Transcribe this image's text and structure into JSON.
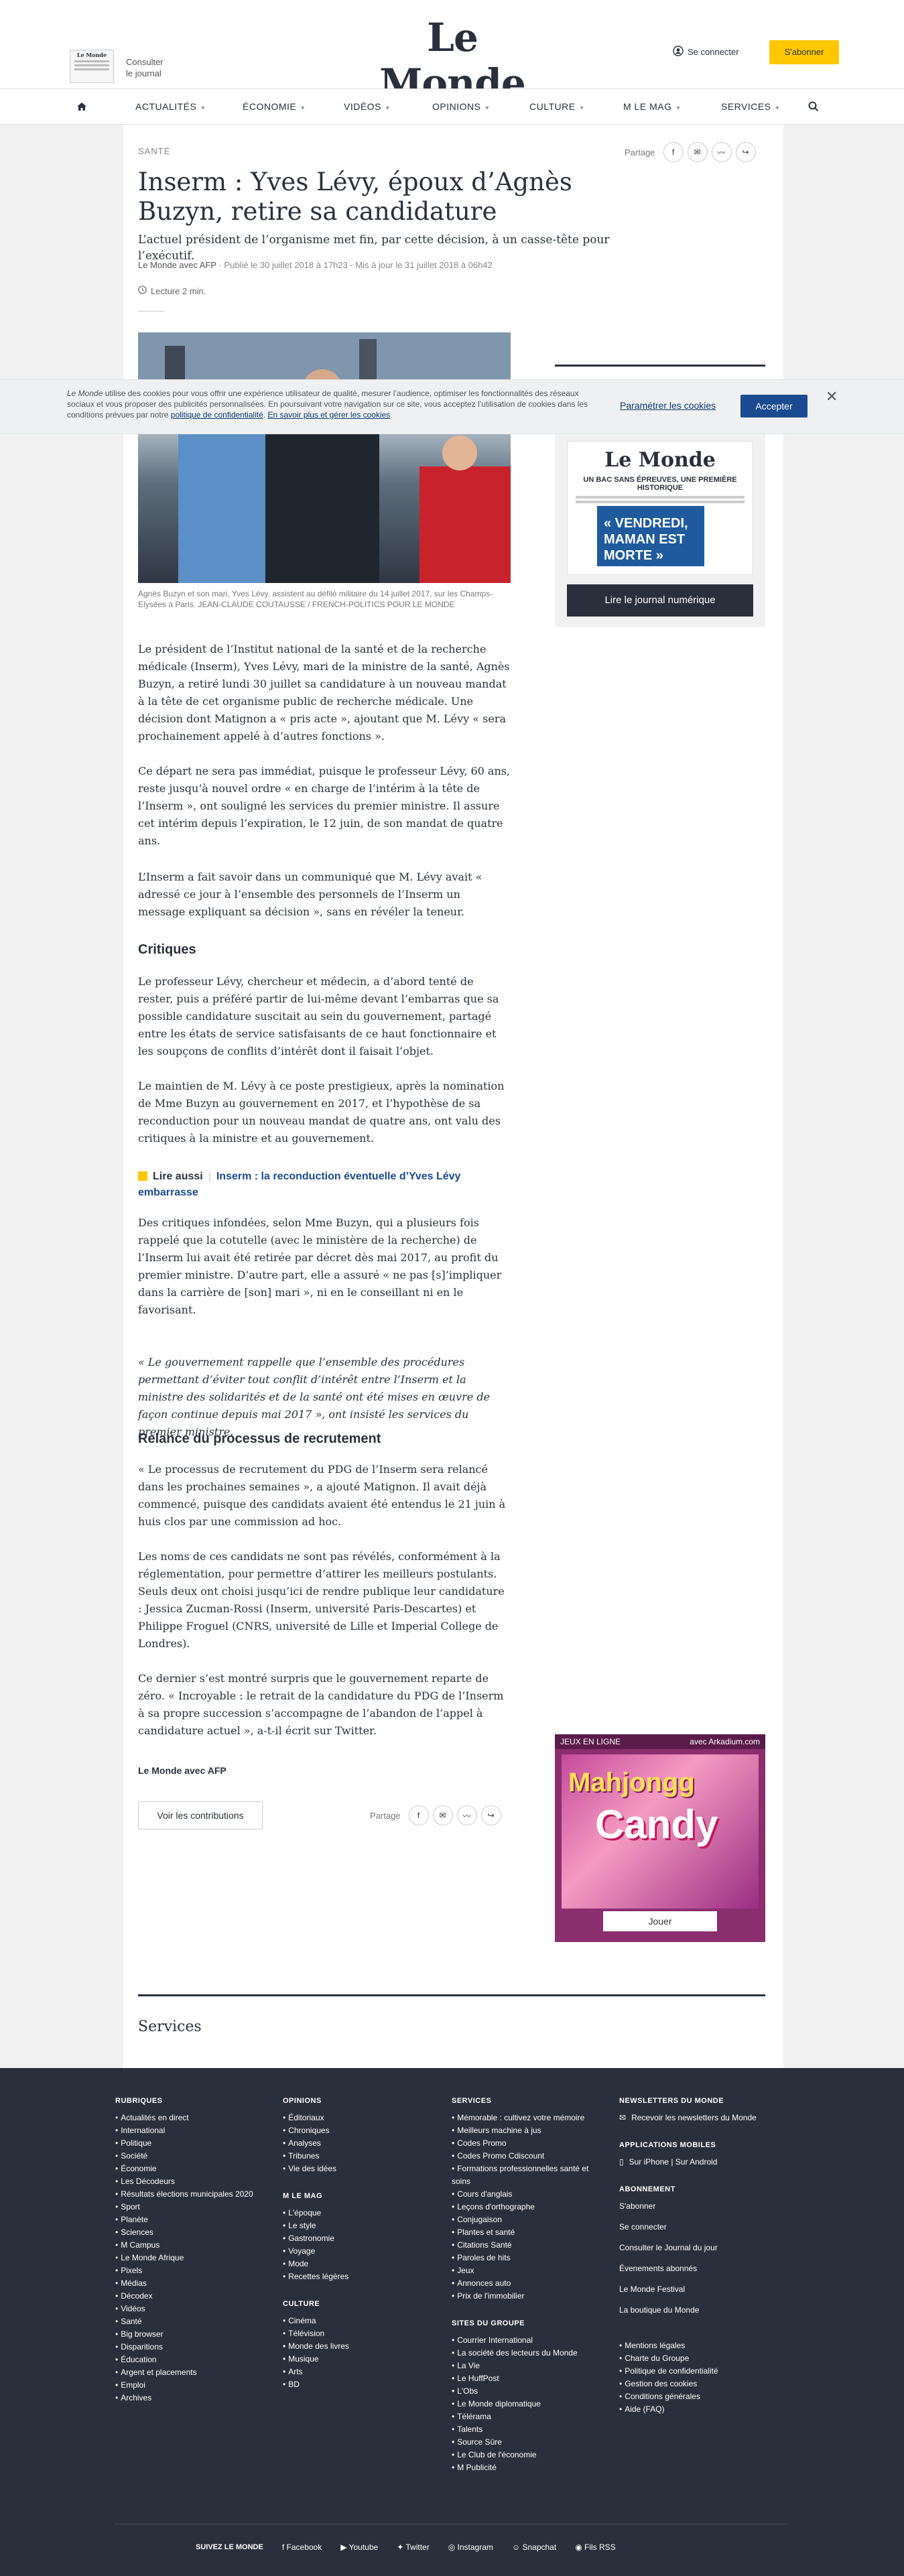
{
  "header": {
    "logo": "Le Monde",
    "paper_mini_title": "Le Monde",
    "consult_line1": "Consulter",
    "consult_line2": "le journal",
    "connect": "Se connecter",
    "subscribe": "S'abonner"
  },
  "nav": {
    "items": [
      {
        "label": "ACTUALITÉS",
        "chev": true
      },
      {
        "label": "ÉCONOMIE",
        "chev": true
      },
      {
        "label": "VIDÉOS",
        "chev": true
      },
      {
        "label": "OPINIONS",
        "chev": true
      },
      {
        "label": "CULTURE",
        "chev": true
      },
      {
        "label": "M LE MAG",
        "chev": true
      },
      {
        "label": "SERVICES",
        "chev": true
      }
    ]
  },
  "cookie": {
    "text_brand": "Le Monde",
    "text": " utilise des cookies pour vous offrir une expérience utilisateur de qualité, mesurer l’audience, optimiser les fonctionnalités des réseaux sociaux et vous proposer des publicités personnalisées. En poursuivant votre navigation sur ce site, vous acceptez l’utilisation de cookies dans les conditions prévues par notre ",
    "link1": "politique de confidentialité",
    "link_sep": ". ",
    "link2": "En savoir plus et gérer les cookies",
    "param": "Paramétrer les cookies",
    "accept": "Accepter",
    "close": "✕"
  },
  "article": {
    "kicker": "SANTÉ",
    "share_label": "Partage",
    "title": "Inserm : Yves Lévy, époux d’Agnès Buzyn, retire sa candidature",
    "description": "L’actuel président de l’organisme met fin, par cette décision, à un casse-tête pour l’exécutif.",
    "meta_author": "Le Monde avec AFP",
    "meta_published": "Publié le 30 juillet 2018 à 17h23 - Mis à jour le 31 juillet 2018 à 06h42",
    "reading": "Lecture 2 min.",
    "caption": "Agnès Buzyn et son mari, Yves Lévy, assistent au défilé militaire du 14 juillet 2017, sur les Champs-Elysées à Paris. JEAN-CLAUDE COUTAUSSE / FRENCH-POLITICS POUR LE MONDE",
    "p1": "Le président de l’Institut national de la santé et de la recherche médicale (Inserm), Yves Lévy, mari de la ministre de la santé, Agnès Buzyn, a retiré lundi 30 juillet sa candidature à un nouveau mandat à la tête de cet organisme public de recherche médicale. Une décision dont Matignon a « pris acte », ajoutant que M. Lévy « sera prochainement appelé à d’autres fonctions ».",
    "p2": "Ce départ ne sera pas immédiat, puisque le professeur Lévy, 60 ans, reste jusqu’à nouvel ordre « en charge de l’intérim à la tête de l’Inserm », ont souligné les services du premier ministre. Il assure cet intérim depuis l’expiration, le 12 juin, de son mandat de quatre ans.",
    "p3": "L’Inserm a fait savoir dans un communiqué que M. Lévy avait « adressé ce jour à l’ensemble des personnels de l’Inserm un message expliquant sa décision », sans en révéler la teneur.",
    "h_critiques": "Critiques",
    "p4": "Le professeur Lévy, chercheur et médecin, a d’abord tenté de rester, puis a préféré partir de lui-même devant l’embarras que sa possible candidature suscitait au sein du gouvernement, partagé entre les états de service satisfaisants de ce haut fonctionnaire et les soupçons de conflits d’intérêt dont il faisait l’objet.",
    "p5": "Le maintien de M. Lévy à ce poste prestigieux, après la nomination de Mme Buzyn au gouvernement en 2017, et l’hypothèse de sa reconduction pour un nouveau mandat de quatre ans, ont valu des critiques à la ministre et au gouvernement.",
    "lire_label": "Lire aussi",
    "lire_link": "Inserm : la reconduction éventuelle d’Yves Lévy embarrasse",
    "p6": "Des critiques infondées, selon Mme Buzyn, qui a plusieurs fois rappelé que la cotutelle (avec le ministère de la recherche) de l’Inserm lui avait été retirée par décret dès mai 2017, au profit du premier ministre. D’autre part, elle a assuré « ne pas [s]’impliquer dans la carrière de [son] mari », ni en le conseillant ni en le favorisant.",
    "p7": "« Le gouvernement rappelle que l’ensemble des procédures permettant d’éviter tout conflit d’intérêt entre l’Inserm et la ministre des solidarités et de la santé ont été mises en œuvre de façon continue depuis mai 2017 », ont insisté les services du premier ministre.",
    "h_relance": "Relance du processus de recrutement",
    "p8": "« Le processus de recrutement du PDG de l’Inserm sera relancé dans les prochaines semaines », a ajouté Matignon. Il avait déjà commencé, puisque des candidats avaient été entendus le 21 juin à huis clos par une commission ad hoc.",
    "p9": "Les noms de ces candidats ne sont pas révélés, conformément à la réglementation, pour permettre d’attirer les meilleurs postulants. Seuls deux ont choisi jusqu’ici de rendre publique leur candidature : Jessica Zucman-Rossi (Inserm, université Paris-Descartes) et Philippe Froguel (CNRS, université de Lille et Imperial College de Londres).",
    "p10": "Ce dernier s’est montré surpris que le gouvernement reparte de zéro. « Incroyable : le retrait de la candidature du PDG de l’Inserm à sa propre succession s’accompagne de l’abandon de l’appel à candidature actuel », a-t-il écrit sur Twitter.",
    "signature": "Le Monde avec AFP",
    "contrib": "Voir les contributions"
  },
  "sidebar": {
    "paper_logo": "Le Monde",
    "paper_head": "UN BAC SANS ÉPREUVES, UNE PREMIÈRE HISTORIQUE",
    "paper_quote": "« VENDREDI, MAMAN EST MORTE »",
    "read_button": "Lire le journal numérique",
    "games_label": "JEUX EN LIGNE",
    "games_partner": "avec Arkadium.com",
    "games_title1": "Mahjongg",
    "games_title2": "Candy",
    "games_play": "Jouer"
  },
  "services": {
    "title": "Services"
  },
  "footer": {
    "col1_title": "RUBRIQUES",
    "col1": [
      "Actualités en direct",
      "International",
      "Politique",
      "Société",
      "Économie",
      "Les Décodeurs",
      "Résultats élections municipales 2020",
      "Sport",
      "Planète",
      "Sciences",
      "M Campus",
      "Le Monde Afrique",
      "Pixels",
      "Médias",
      "Décodex",
      "Vidéos",
      "Santé",
      "Big browser",
      "Disparitions",
      "Éducation",
      "Argent et placements",
      "Emploi",
      "Archives"
    ],
    "col2_title": "OPINIONS",
    "col2": [
      "Éditoriaux",
      "Chroniques",
      "Analyses",
      "Tribunes",
      "Vie des idées"
    ],
    "col2b_title": "M LE MAG",
    "col2b": [
      "L'époque",
      "Le style",
      "Gastronomie",
      "Voyage",
      "Mode",
      "Recettes légères"
    ],
    "col2c_title": "CULTURE",
    "col2c": [
      "Cinéma",
      "Télévision",
      "Monde des livres",
      "Musique",
      "Arts",
      "BD"
    ],
    "col3_title": "SERVICES",
    "col3": [
      "Mémorable : cultivez votre mémoire",
      "Meilleurs machine à jus",
      "Codes Promo",
      "Codes Promo Cdiscount",
      "Formations professionnelles santé et soins",
      "Cours d'anglais",
      "Leçons d'orthographe",
      "Conjugaison",
      "Plantes et santé",
      "Citations Santé",
      "Paroles de hits",
      "Jeux",
      "Annonces auto",
      "Prix de l'immobilier"
    ],
    "col3b_title": "SITES DU GROUPE",
    "col3b": [
      "Courrier International",
      "La société des lecteurs du Monde",
      "La Vie",
      "Le HuffPost",
      "L'Obs",
      "Le Monde diplomatique",
      "Télérama",
      "Talents",
      "Source Sûre",
      "Le Club de l'économie",
      "M Publicité"
    ],
    "col4_title": "NEWSLETTERS DU MONDE",
    "col4_news": "Recevoir les newsletters du Monde",
    "col4b_title": "APPLICATIONS MOBILES",
    "col4b_apps": "Sur iPhone | Sur Android",
    "col4c_title": "ABONNEMENT",
    "col4c": [
      "S'abonner",
      "Se connecter",
      "Consulter le Journal du jour",
      "Évenements abonnés",
      "Le Monde Festival",
      "La boutique du Monde"
    ],
    "col4d": [
      "Mentions légales",
      "Charte du Groupe",
      "Politique de confidentialité",
      "Gestion des cookies",
      "Conditions générales",
      "Aide (FAQ)"
    ],
    "follow": "SUIVEZ LE MONDE",
    "social": [
      "Facebook",
      "Youtube",
      "Twitter",
      "Instagram",
      "Snapchat",
      "Fils RSS"
    ]
  }
}
